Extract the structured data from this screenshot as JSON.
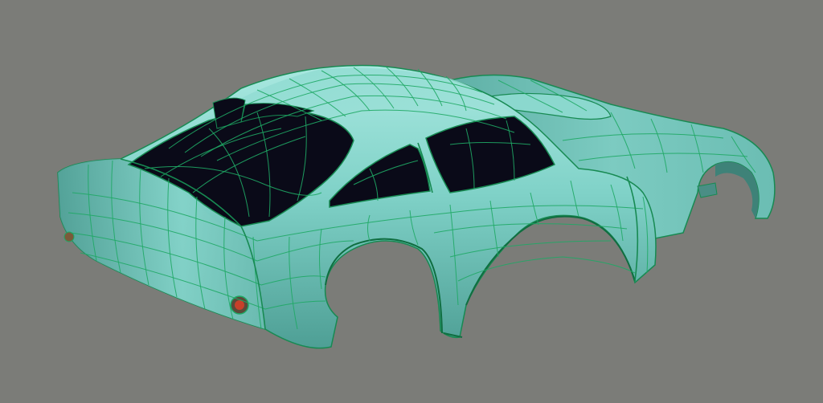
{
  "viewport": {
    "background": "#7b7c78",
    "subject": "car-body-wireframe-model",
    "colors": {
      "surface": "#7fd3c9",
      "surface_dark": "#4fa79d",
      "surface_light": "#a8e6de",
      "wireframe": "#1fa865",
      "glass": "#0a0a18",
      "light": "#c8402a"
    }
  }
}
